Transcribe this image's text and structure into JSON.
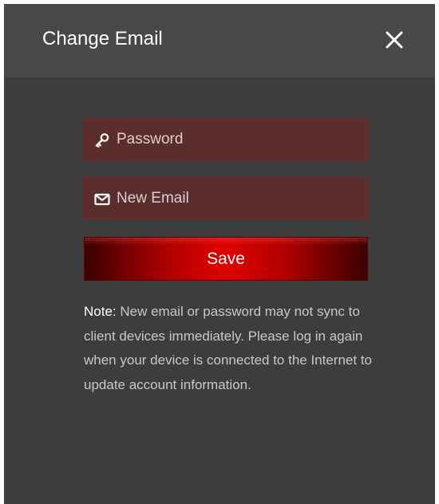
{
  "dialog": {
    "title": "Change Email",
    "close_icon": "close-icon"
  },
  "form": {
    "password": {
      "placeholder": "Password",
      "value": "",
      "icon": "key-icon"
    },
    "new_email": {
      "placeholder": "New Email",
      "value": "",
      "icon": "envelope-icon"
    },
    "save_label": "Save"
  },
  "note": {
    "label": "Note:",
    "text": " New email or password may not sync to client devices immediately. Please log in again when your device is connected to the Internet to update account information."
  },
  "colors": {
    "dialog_background": "#3d3d3d",
    "header_background": "#484848",
    "field_background": "#5c2d2d",
    "field_border": "#8a1a1a",
    "accent_red": "#e00000"
  }
}
